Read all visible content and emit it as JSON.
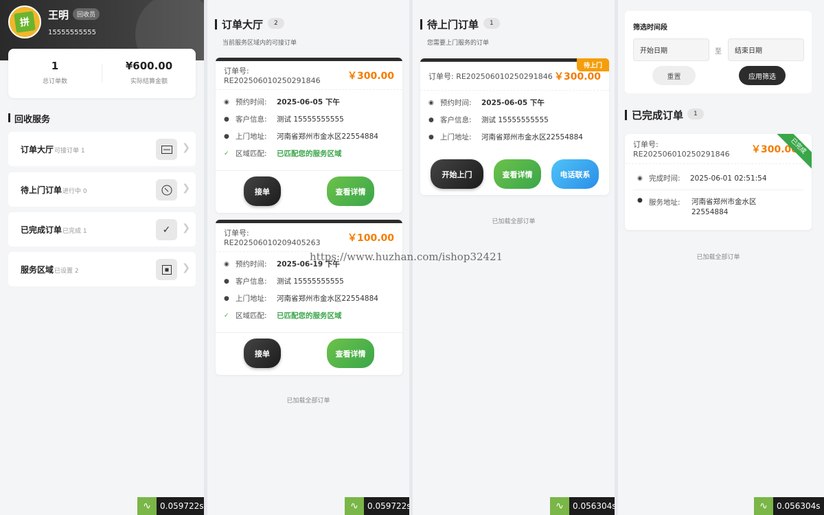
{
  "profile": {
    "name": "王明",
    "role": "回收员",
    "phone": "15555555555",
    "avatar_letter": "拼"
  },
  "stats": [
    {
      "value": "1",
      "label": "总订单数"
    },
    {
      "value": "¥600.00",
      "label": "实际结算金额"
    }
  ],
  "services_title": "回收服务",
  "menu": [
    {
      "title": "订单大厅",
      "sub": "可接订单 1",
      "icon": "list-icon"
    },
    {
      "title": "待上门订单",
      "sub": "进行中 0",
      "icon": "clock-icon"
    },
    {
      "title": "已完成订单",
      "sub": "已完成 1",
      "icon": "check-icon"
    },
    {
      "title": "服务区域",
      "sub": "已设置 2",
      "icon": "area-icon"
    }
  ],
  "hall": {
    "title": "订单大厅",
    "count": "2",
    "subtitle": "当前服务区域内的可接订单",
    "labels": {
      "order_no": "订单号:",
      "time": "预约时间:",
      "customer": "客户信息:",
      "address": "上门地址:",
      "area": "区域匹配:"
    },
    "orders": [
      {
        "no": "RE202506010250291846",
        "price": "￥300.00",
        "time": "2025-06-05 下午",
        "customer": "测试 15555555555",
        "address": "河南省郑州市金水区22554884",
        "area": "已匹配您的服务区域",
        "accept": "接单",
        "detail": "查看详情"
      },
      {
        "no": "RE202506010209405263",
        "price": "￥100.00",
        "time": "2025-06-19 下午",
        "customer": "测试 15555555555",
        "address": "河南省郑州市金水区22554884",
        "area": "已匹配您的服务区域",
        "accept": "接单",
        "detail": "查看详情"
      }
    ],
    "loaded": "已加载全部订单"
  },
  "pending": {
    "title": "待上门订单",
    "count": "1",
    "subtitle": "您需要上门服务的订单",
    "order": {
      "no": "RE202506010250291846",
      "price": "￥300.00",
      "badge": "待上门",
      "time": "2025-06-05 下午",
      "customer": "测试 15555555555",
      "address": "河南省郑州市金水区22554884"
    },
    "labels": {
      "order_no": "订单号:",
      "time": "预约时间:",
      "customer": "客户信息:",
      "address": "上门地址:"
    },
    "buttons": {
      "start": "开始上门",
      "detail": "查看详情",
      "call": "电话联系"
    },
    "loaded": "已加载全部订单"
  },
  "completed": {
    "filter": {
      "label": "筛选时间段",
      "start_placeholder": "开始日期",
      "to": "至",
      "end_placeholder": "结束日期",
      "reset": "重置",
      "apply": "应用筛选"
    },
    "title": "已完成订单",
    "count": "1",
    "order": {
      "no": "RE202506010250291846",
      "price": "￥300.00",
      "badge": "已完成",
      "done_label": "完成时间:",
      "done_time": "2025-06-01 02:51:54",
      "addr_label": "服务地址:",
      "address": "河南省郑州市金水区22554884"
    },
    "order_label": "订单号:",
    "loaded": "已加载全部订单"
  },
  "timers": [
    "0.059722s",
    "0.059722s",
    "0.056304s",
    "0.056304s"
  ],
  "watermark": "https://www.huzhan.com/ishop32421"
}
